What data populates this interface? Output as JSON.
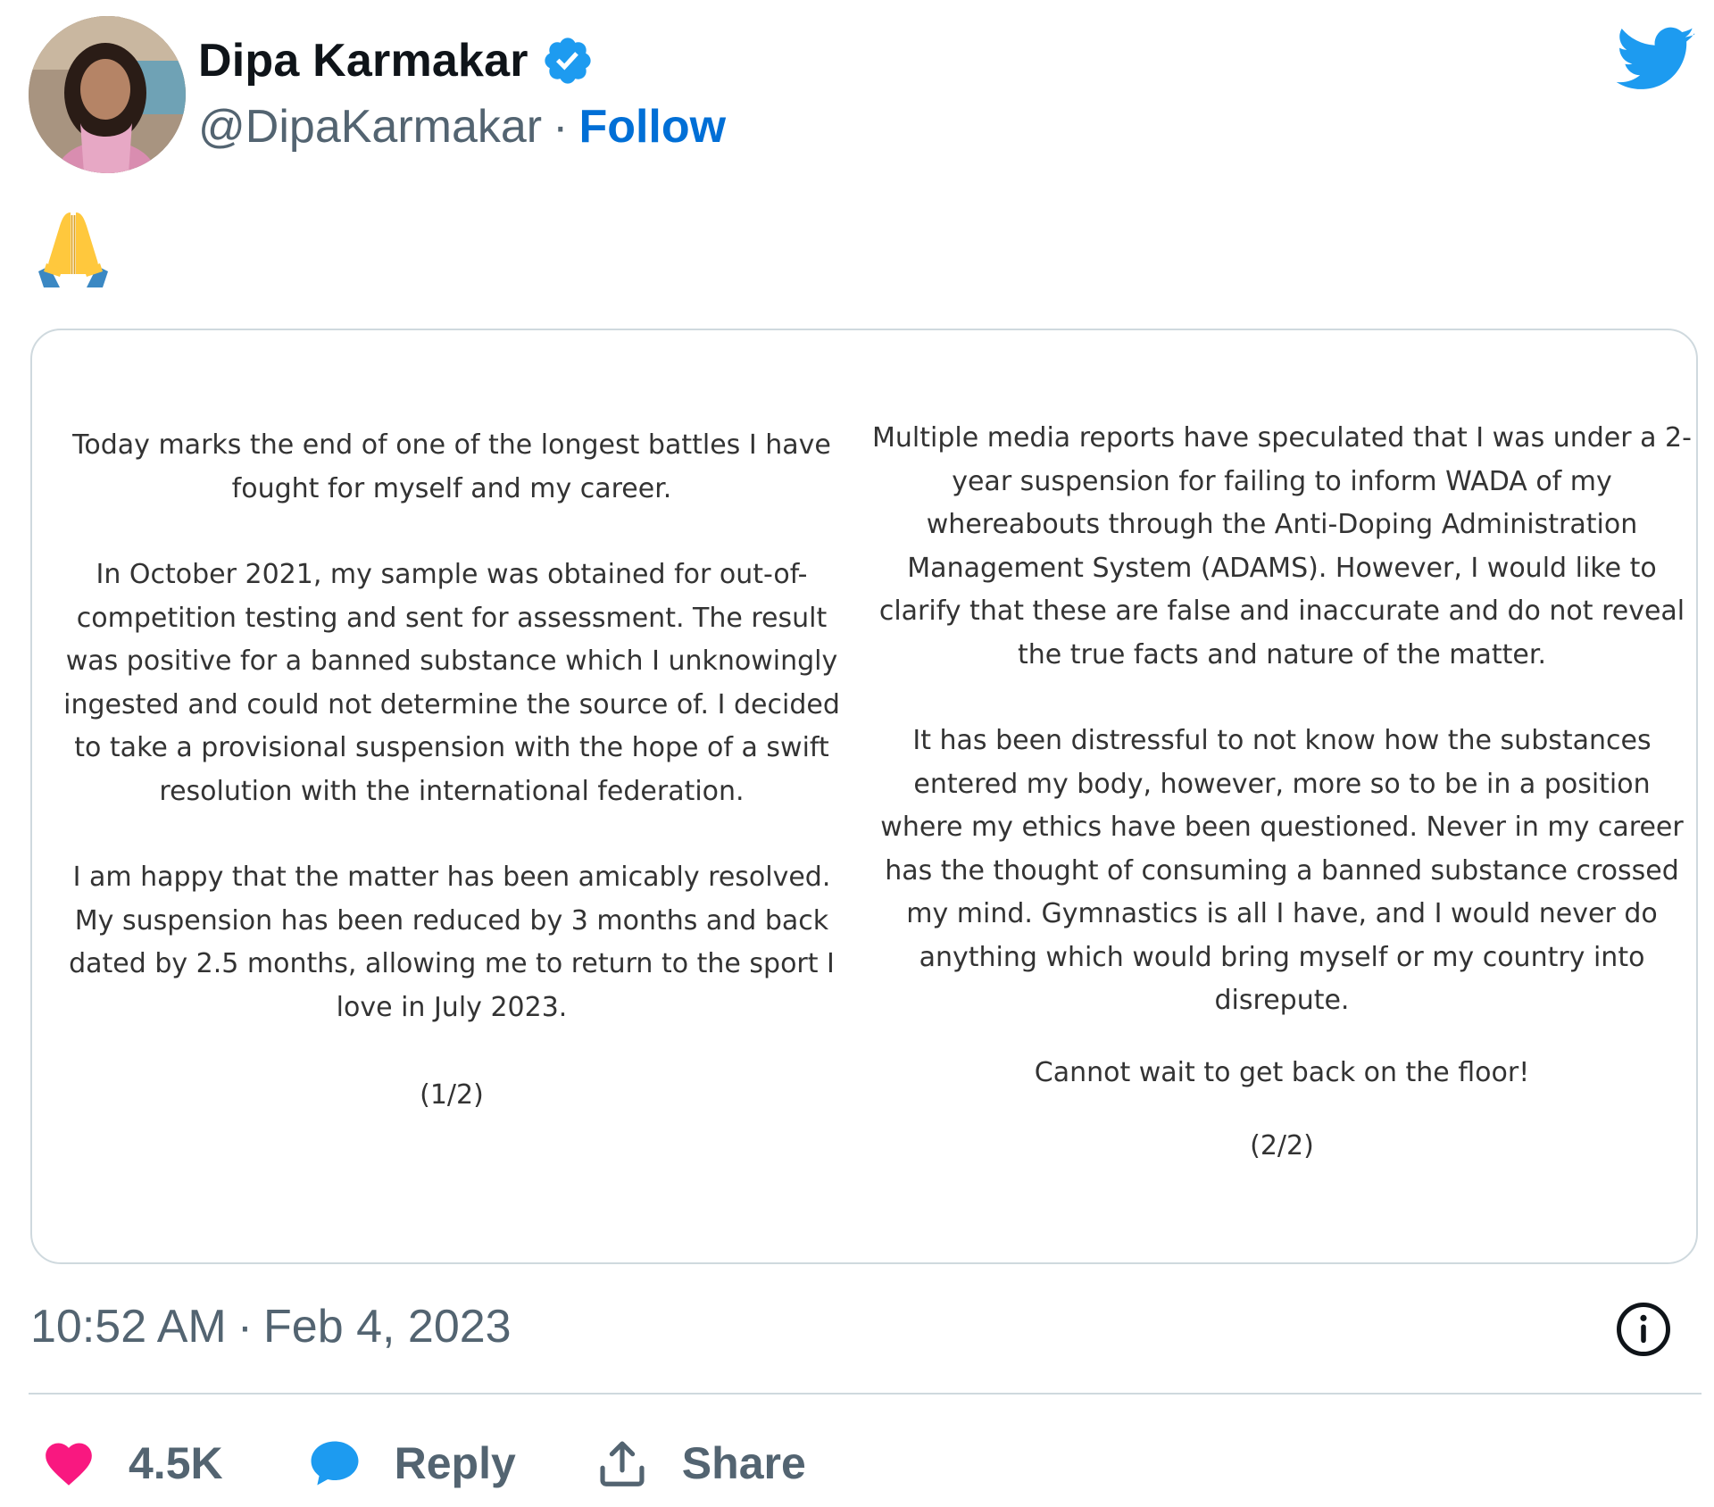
{
  "author": {
    "display_name": "Dipa Karmakar",
    "handle": "@DipaKarmakar",
    "separator": "·",
    "follow_label": "Follow",
    "verified": true
  },
  "tweet": {
    "emoji": "🙏",
    "statement": {
      "left": {
        "paragraphs": [
          "Today marks the end of one of the longest battles I have fought for myself and my career.",
          "In October 2021, my sample was obtained for out-of-competition testing and sent for assessment. The result was positive for a banned substance which I unknowingly ingested and could not determine the source of.  I decided to take a provisional suspension with the hope of a swift resolution with the international federation.",
          "I am happy that the matter has been amicably resolved. My suspension has been reduced by 3 months and back dated by 2.5 months, allowing me to return to the sport I love in July 2023."
        ],
        "page_marker": "(1/2)"
      },
      "right": {
        "paragraphs": [
          "Multiple media reports have speculated that I was under a 2-year suspension for failing to inform WADA of my whereabouts through the Anti-Doping Administration Management System (ADAMS). However, I would like to clarify that these are false and inaccurate and do not reveal the true facts and nature of the matter.",
          "It has been distressful to not know how the substances entered my body, however, more so to be in a position where my ethics have been questioned. Never in my career has the thought of consuming a banned substance crossed my mind. Gymnastics is all I have, and I would never do anything which would bring myself or my country into disrepute."
        ],
        "closing": "Cannot wait to get back on the floor!",
        "page_marker": "(2/2)"
      }
    },
    "time": "10:52 AM",
    "time_separator": "·",
    "date": "Feb 4, 2023"
  },
  "actions": {
    "likes_count": "4.5K",
    "reply_label": "Reply",
    "share_label": "Share"
  },
  "icons": {
    "verified": "verified-badge-icon",
    "logo": "twitter-bird-icon",
    "info": "info-icon",
    "like": "heart-icon",
    "reply": "speech-bubble-icon",
    "share": "share-upload-icon"
  },
  "colors": {
    "follow_link": "#006fd6",
    "twitter_blue": "#1d9bf0",
    "heart": "#f91880",
    "secondary_text": "#536471",
    "border": "#cfd9de"
  }
}
